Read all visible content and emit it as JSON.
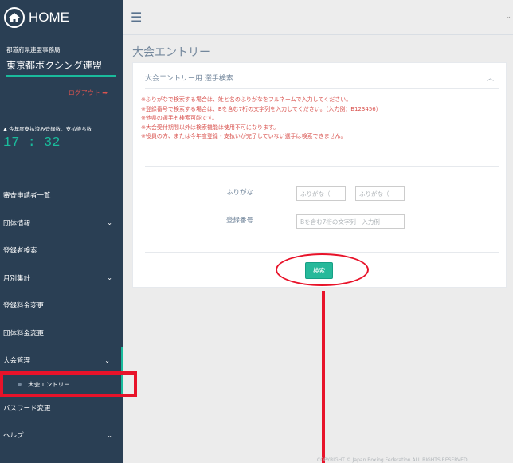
{
  "brand": {
    "label": "HOME",
    "icon": "home-icon"
  },
  "org": {
    "small_label": "都道府県連盟事務局",
    "name": "東京都ボクシング連盟",
    "logout": "ログアウト ➡"
  },
  "registration": {
    "label": "今年度支払済み登録数：支払待ち数",
    "count": "17 : 32"
  },
  "nav": {
    "items": [
      {
        "label": "審査申請者一覧",
        "chevron": ""
      },
      {
        "label": "団体情報",
        "chevron": "⌄"
      },
      {
        "label": "登録者検索",
        "chevron": ""
      },
      {
        "label": "月別集計",
        "chevron": "⌄"
      },
      {
        "label": "登録料金変更",
        "chevron": ""
      },
      {
        "label": "団体料金変更",
        "chevron": ""
      },
      {
        "label": "大会管理",
        "chevron": "⌄"
      }
    ],
    "sub_item": "大会エントリー",
    "after_items": [
      {
        "label": "パスワード変更",
        "chevron": ""
      },
      {
        "label": "ヘルプ",
        "chevron": "⌄"
      }
    ]
  },
  "page": {
    "title": "大会エントリー"
  },
  "panel": {
    "title": "大会エントリー用 選手検索",
    "collapse_icon": "︿",
    "notes": [
      "※ふりがなで検索する場合は、姓と名のふりがなをフルネームで入力してください。",
      "※登録番号で検索する場合は、Bを含む7桁の文字列を入力してください。（入力例：B123456）",
      "※他県の選手も検索可能です。",
      "※大会受付期間以外は検索機能は使用不可になります。",
      "※役員の方、または今年度登録・支払いが完了していない選手は検索できません。"
    ],
    "furigana_label": "ふりがな",
    "furigana_sei_placeholder": "ふりがな（",
    "furigana_mei_placeholder": "ふりがな（",
    "reg_label": "登録番号",
    "reg_placeholder": "Bを含む7桁の文字列　入力例",
    "search_button": "検索"
  },
  "footer": {
    "text": "COPYRIGHT © Japan Boxing Federation ALL RIGHTS RESERVED"
  },
  "colors": {
    "sidebar": "#2a3f54",
    "accent": "#1abb9c",
    "annotation": "#e8132a",
    "button": "#26b99a"
  }
}
